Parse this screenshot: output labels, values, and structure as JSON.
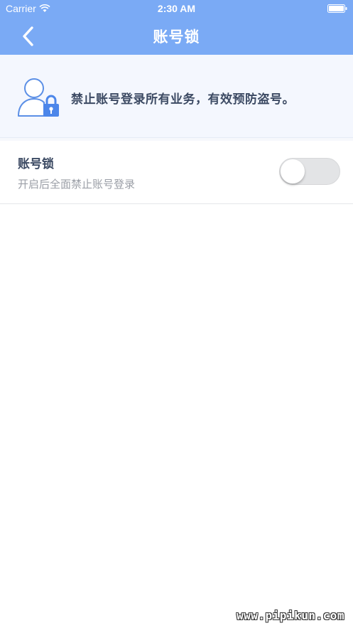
{
  "statusbar": {
    "carrier": "Carrier",
    "time": "2:30 AM"
  },
  "navbar": {
    "title": "账号锁",
    "back_icon": "chevron-left-icon"
  },
  "banner": {
    "icon": "user-lock-icon",
    "text": "禁止账号登录所有业务，有效预防盗号。"
  },
  "setting": {
    "title": "账号锁",
    "description": "开启后全面禁止账号登录",
    "toggle_on": false
  },
  "watermark": "www.pipikun.com",
  "colors": {
    "accent": "#7aaaf5",
    "banner_bg": "#f4f7fe",
    "title_text": "#3c4a63",
    "desc_text": "#9a9ea6"
  }
}
